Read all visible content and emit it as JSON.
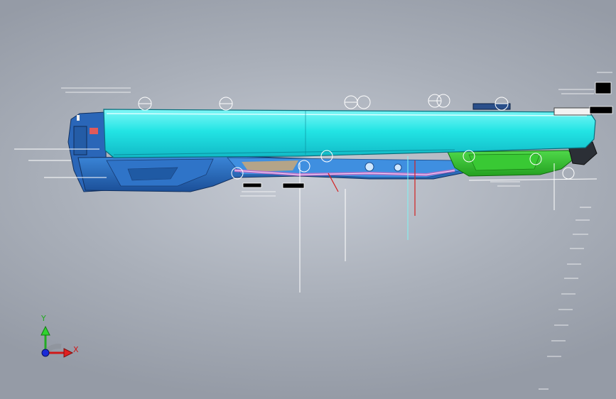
{
  "viewport": {
    "background": "#b4b9c2",
    "colors": {
      "top_shell": "#1fe6e6",
      "body_blue": "#1e5fb0",
      "body_blue_light": "#3b86d8",
      "green_part": "#2fbf2a",
      "pipe": "#b872c8",
      "tan_part": "#c9a878",
      "dim_line": "#ffffff",
      "red_line": "#d42020"
    }
  },
  "triad": {
    "x_label": "X",
    "y_label": "Y",
    "icon": "coordinate-triad-icon"
  }
}
